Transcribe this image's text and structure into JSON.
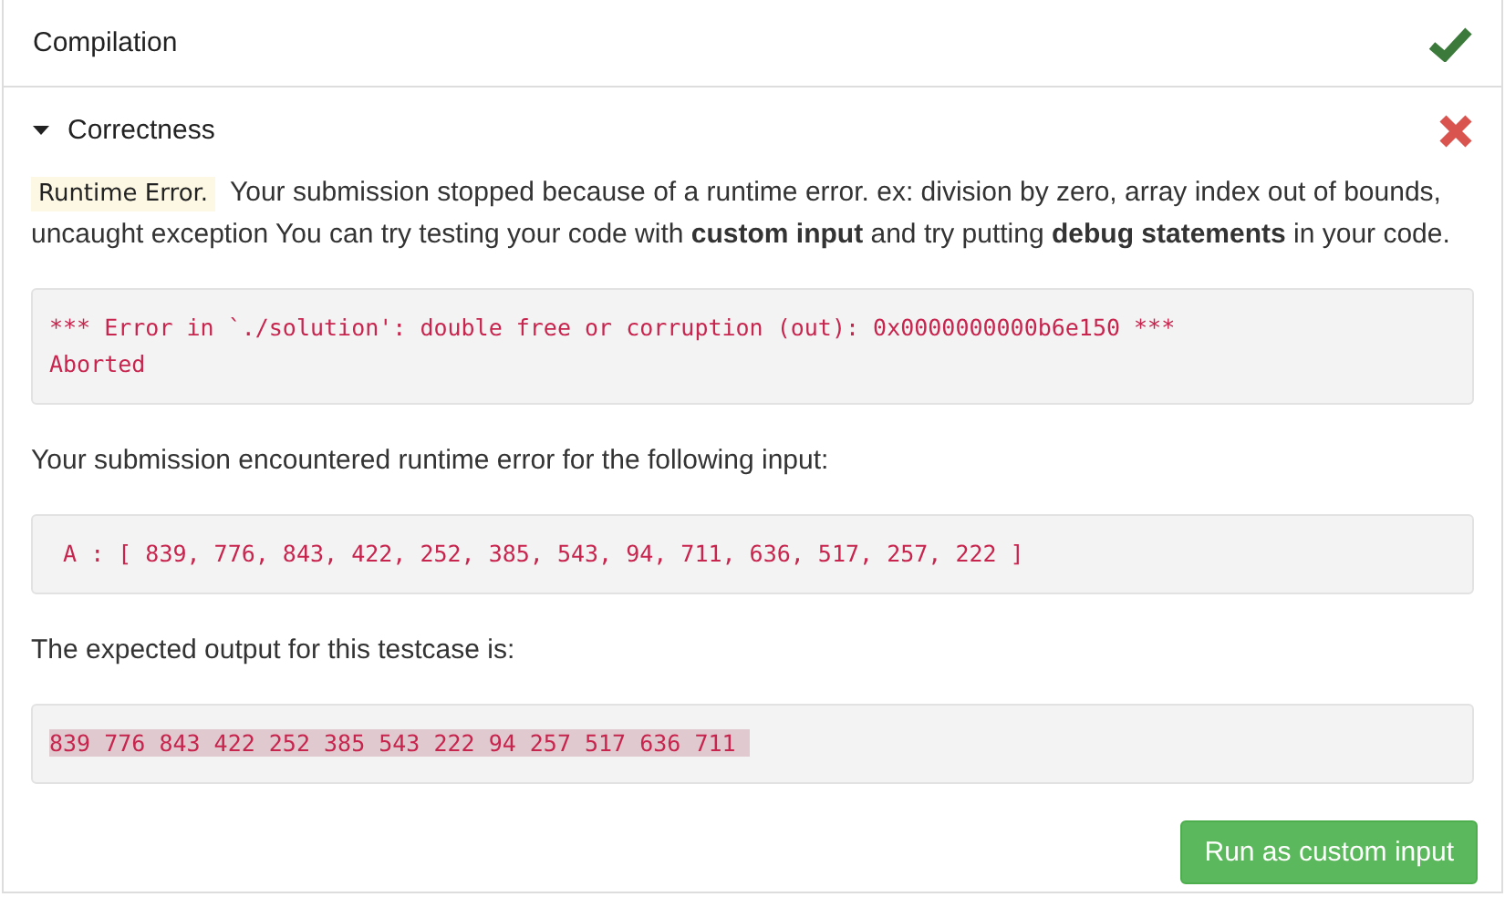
{
  "sections": [
    {
      "title": "Compilation",
      "passed": true,
      "expanded": false
    },
    {
      "title": "Correctness",
      "passed": false,
      "expanded": true
    }
  ],
  "error": {
    "badge": "Runtime Error.",
    "message": "Your submission stopped because of a runtime error. ex: division by zero, array index out of bounds, uncaught exception You can try testing your code with **custom input** and try putting **debug statements** in your code."
  },
  "error_output": [
    "*** Error in `./solution': double free or corruption (out): 0x0000000000b6e150 ***",
    "Aborted"
  ],
  "input_label": "Your submission encountered runtime error for the following input:",
  "input_value": "A : [ 839, 776, 843, 422, 252, 385, 543, 94, 711, 636, 517, 257, 222 ]",
  "expected_label": "The expected output for this testcase is:",
  "expected_output": {
    "text": "839 776 843 422 252 385 543 222 94 257 517 636 711 ",
    "highlighted": true
  },
  "button": "Run as custom input"
}
